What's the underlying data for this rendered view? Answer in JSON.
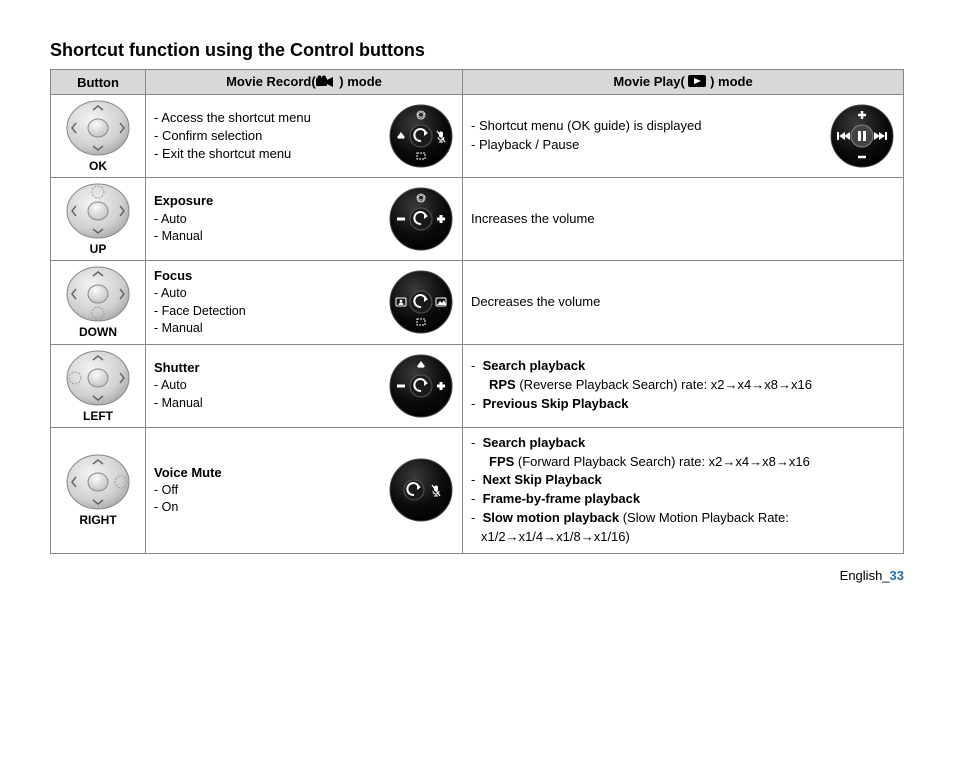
{
  "title": "Shortcut function using the Control buttons",
  "headers": {
    "button": "Button",
    "record": "Movie Record(",
    "record_suffix": " ) mode",
    "play": "Movie Play( ",
    "play_suffix": " ) mode"
  },
  "rows": {
    "ok": {
      "label": "OK",
      "record": [
        "- Access the shortcut menu",
        "- Confirm selection",
        "- Exit the shortcut menu"
      ],
      "play": [
        "- Shortcut menu (OK guide) is displayed",
        "- Playback / Pause"
      ]
    },
    "up": {
      "label": "UP",
      "record_title": "Exposure",
      "record_items": [
        "- Auto",
        "- Manual"
      ],
      "play": "Increases the volume"
    },
    "down": {
      "label": "DOWN",
      "record_title": "Focus",
      "record_items": [
        "- Auto",
        "- Face Detection",
        "- Manual"
      ],
      "play": "Decreases the volume"
    },
    "left": {
      "label": "LEFT",
      "record_title": "Shutter",
      "record_items": [
        "- Auto",
        "- Manual"
      ],
      "play_search_label": "Search playback",
      "play_rps_bold": "RPS",
      "play_rps_text": " (Reverse Playback Search) rate: x2→x4→x8→x16",
      "play_prev": "Previous Skip Playback"
    },
    "right": {
      "label": "RIGHT",
      "record_title": "Voice Mute",
      "record_items": [
        "- Off",
        "- On"
      ],
      "play_search_label": "Search playback",
      "play_fps_bold": "FPS",
      "play_fps_text": " (Forward Playback Search) rate: x2→x4→x8→x16",
      "play_next": "Next Skip Playback",
      "play_fbf": "Frame-by-frame playback",
      "play_slow_bold": "Slow motion playback",
      "play_slow_text": " (Slow Motion Playback Rate: x1/2→x1/4→x1/8→x1/16)"
    }
  },
  "dash": "-  ",
  "footer_lang": "English",
  "footer_sep": "_",
  "footer_page": "33"
}
